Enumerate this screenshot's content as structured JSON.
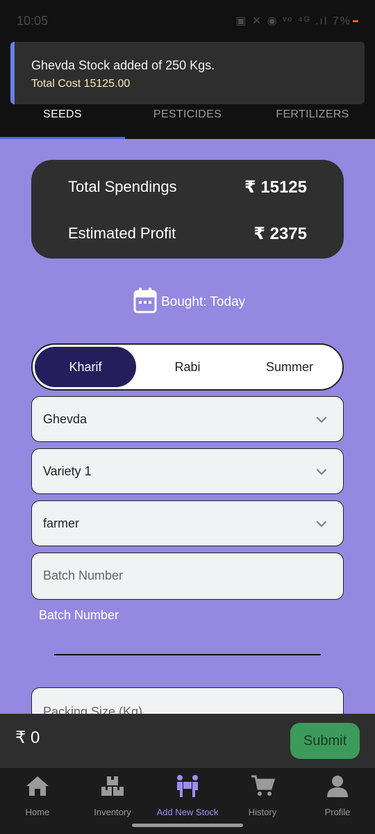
{
  "status_bar": {
    "time": "10:05",
    "icons": "▣ ✕ ◉ ᵛᵒ ⁴ᴳ .ıl",
    "battery": "7%"
  },
  "snackbar": {
    "title": "Ghevda Stock added of 250 Kgs.",
    "subtitle": "Total Cost 15125.00"
  },
  "tabs": [
    {
      "label": "SEEDS",
      "active": true
    },
    {
      "label": "PESTICIDES",
      "active": false
    },
    {
      "label": "FERTILIZERS",
      "active": false
    }
  ],
  "summary": {
    "spendings_label": "Total Spendings",
    "spendings_value": "₹ 15125",
    "profit_label": "Estimated Profit",
    "profit_value": "₹ 2375"
  },
  "bought": {
    "icon": "calendar-icon",
    "text": "Bought: Today"
  },
  "seasons": [
    {
      "label": "Kharif",
      "active": true
    },
    {
      "label": "Rabi",
      "active": false
    },
    {
      "label": "Summer",
      "active": false
    }
  ],
  "form": {
    "crop": "Ghevda",
    "variety": "Variety 1",
    "source": "farmer",
    "batch_placeholder": "Batch Number",
    "batch_label": "Batch Number",
    "packing_placeholder": "Packing Size (Kg)"
  },
  "footer": {
    "total": "₹ 0",
    "submit_label": "Submit"
  },
  "nav": [
    {
      "label": "Home",
      "icon": "home-icon",
      "active": false
    },
    {
      "label": "Inventory",
      "icon": "boxes-icon",
      "active": false
    },
    {
      "label": "Add New Stock",
      "icon": "people-carry-box-icon",
      "active": true
    },
    {
      "label": "History",
      "icon": "cart-icon",
      "active": false
    },
    {
      "label": "Profile",
      "icon": "user-icon",
      "active": false
    }
  ],
  "colors": {
    "background": "#9488e0",
    "accent": "#9b8ff0",
    "active_season": "#241f5c",
    "submit": "#3c9a5a"
  }
}
